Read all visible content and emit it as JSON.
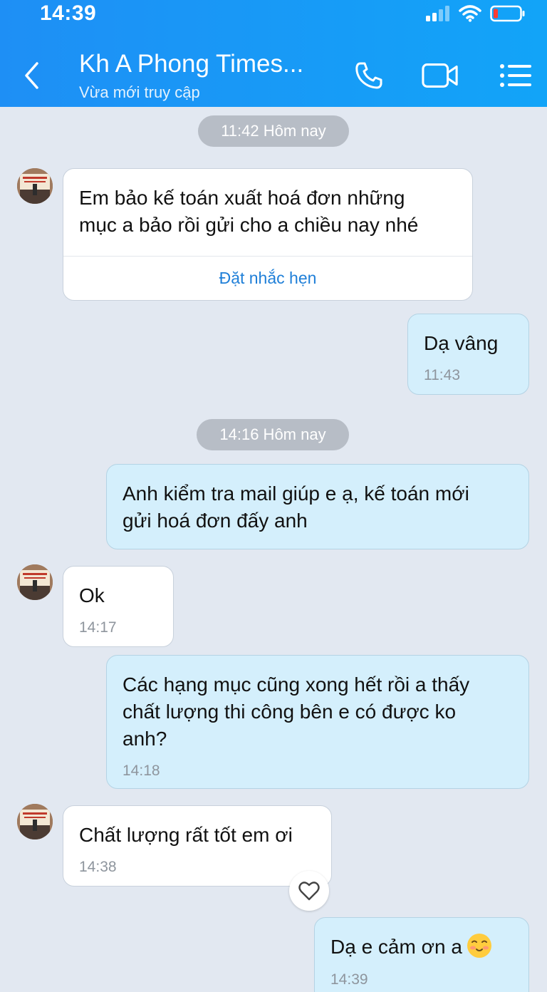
{
  "status_bar": {
    "time": "14:39"
  },
  "header": {
    "title": "Kh A Phong Times...",
    "subtitle": "Vừa mới truy cập"
  },
  "icons": {
    "back": "chevron-left-icon",
    "call": "phone-icon",
    "video": "video-camera-icon",
    "menu": "list-menu-icon",
    "like": "heart-icon",
    "emoji": "smiling-face-emoji"
  },
  "colors": {
    "header": "#1e8ff5",
    "background": "#e2e8f1",
    "outgoing_bubble": "#d4effc",
    "incoming_bubble": "#ffffff",
    "link": "#1f7fd8"
  },
  "conversation": {
    "divider_1": "11:42 Hôm nay",
    "msg_1": {
      "text_line1": "Em bảo kế toán xuất hoá đơn những",
      "text_line2": "mục a bảo rồi gửi cho a chiều nay nhé",
      "action": "Đặt nhắc hẹn"
    },
    "msg_2": {
      "text": "Dạ vâng",
      "time": "11:43"
    },
    "divider_2": "14:16 Hôm nay",
    "msg_3": {
      "text_line1": "Anh kiểm tra mail giúp e ạ, kế toán mới",
      "text_line2": "gửi hoá đơn đấy anh"
    },
    "msg_4": {
      "text": "Ok",
      "time": "14:17"
    },
    "msg_5": {
      "text_line1": "Các hạng mục cũng xong hết rồi a thấy",
      "text_line2": "chất lượng thi công bên e có được ko",
      "text_line3": "anh?",
      "time": "14:18"
    },
    "msg_6": {
      "text": "Chất lượng rất tốt em ơi",
      "time": "14:38"
    },
    "msg_7": {
      "text": "Dạ e cảm ơn a",
      "time": "14:39"
    }
  }
}
